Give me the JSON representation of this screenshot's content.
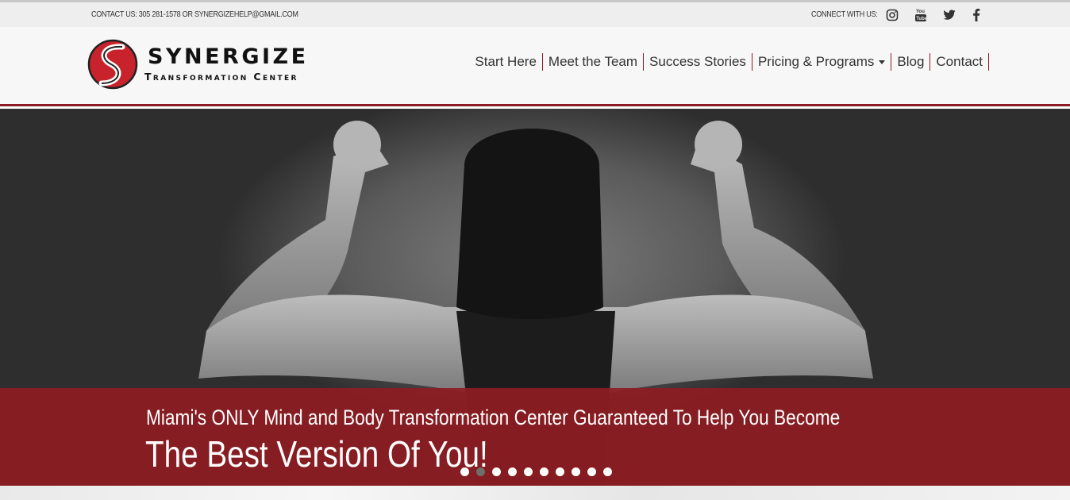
{
  "topbar": {
    "contact": "CONTACT US: 305 281-1578 OR SYNERGIZEHELP@GMAIL.COM",
    "connect_label": "CONNECT WITH US:",
    "social_icons": [
      "instagram-icon",
      "youtube-icon",
      "twitter-icon",
      "facebook-icon"
    ]
  },
  "logo": {
    "title": "SYNERGIZE",
    "subtitle": "Transformation Center"
  },
  "nav": {
    "items": [
      {
        "label": "Start Here"
      },
      {
        "label": "Meet the Team"
      },
      {
        "label": "Success Stories"
      },
      {
        "label": "Pricing & Programs"
      },
      {
        "label": "Blog"
      },
      {
        "label": "Contact"
      }
    ]
  },
  "hero": {
    "headline": "Miami's ONLY Mind and Body Transformation Center Guaranteed To Help You Become",
    "tagline": "The Best Version Of You!",
    "slide_count": 10,
    "active_slide": 2
  },
  "colors": {
    "brand_red": "#8e1c22",
    "header_bg": "#f7f7f7",
    "topbar_bg": "#eeeeee"
  }
}
